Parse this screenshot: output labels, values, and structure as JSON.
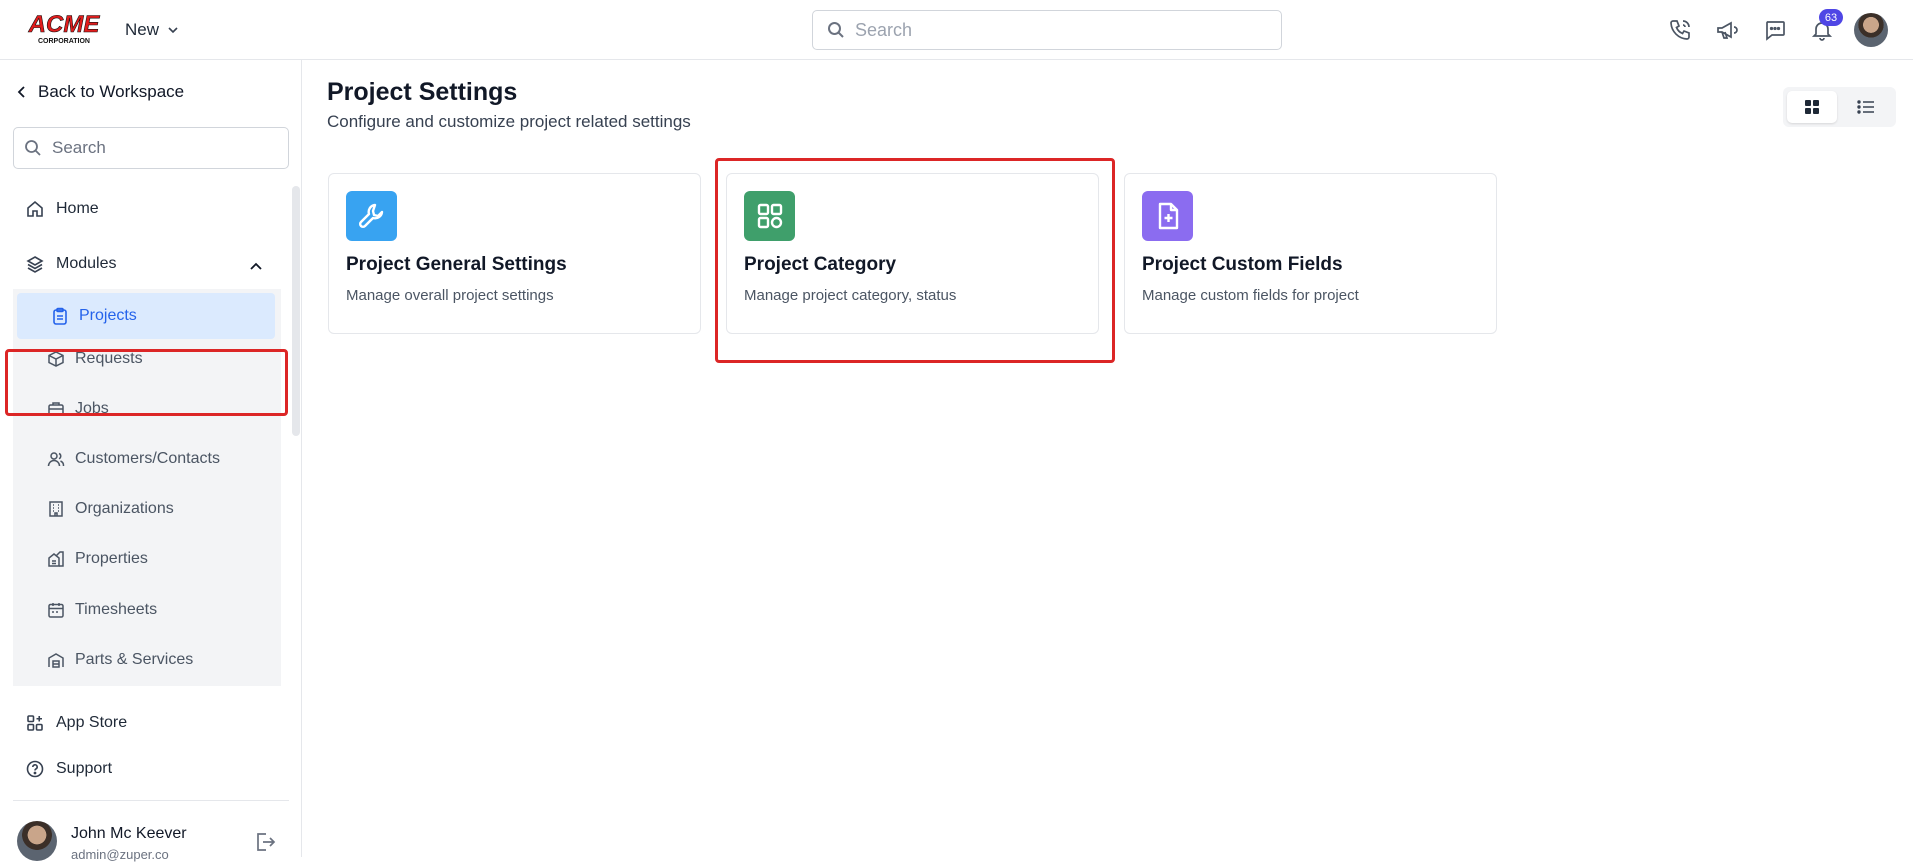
{
  "header": {
    "logo_text": "ACME",
    "logo_subtext": "CORPORATION",
    "new_label": "New",
    "search_placeholder": "Search",
    "notification_count": "63"
  },
  "sidebar": {
    "back_label": "Back to Workspace",
    "search_placeholder": "Search",
    "home_label": "Home",
    "modules_label": "Modules",
    "modules": [
      {
        "label": "Projects",
        "icon": "clipboard-icon",
        "active": true
      },
      {
        "label": "Requests",
        "icon": "box-icon"
      },
      {
        "label": "Jobs",
        "icon": "briefcase-icon"
      },
      {
        "label": "Customers/Contacts",
        "icon": "users-icon"
      },
      {
        "label": "Organizations",
        "icon": "building-icon"
      },
      {
        "label": "Properties",
        "icon": "property-icon"
      },
      {
        "label": "Timesheets",
        "icon": "calendar-icon"
      },
      {
        "label": "Parts & Services",
        "icon": "warehouse-icon"
      }
    ],
    "app_store_label": "App Store",
    "support_label": "Support",
    "user": {
      "name": "John Mc Keever",
      "email": "admin@zuper.co"
    }
  },
  "main": {
    "title": "Project Settings",
    "subtitle": "Configure and customize project related settings",
    "cards": [
      {
        "title": "Project General Settings",
        "description": "Manage overall project settings",
        "icon": "wrench-icon",
        "color": "#38a3f1"
      },
      {
        "title": "Project Category",
        "description": "Manage project category, status",
        "icon": "grid-icon",
        "color": "#3f9f6b"
      },
      {
        "title": "Project Custom Fields",
        "description": "Manage custom fields for project",
        "icon": "file-plus-icon",
        "color": "#8b6cf0"
      }
    ]
  },
  "colors": {
    "accent": "#2563eb",
    "highlight": "#dc2626",
    "active_bg": "#dbeafe"
  }
}
